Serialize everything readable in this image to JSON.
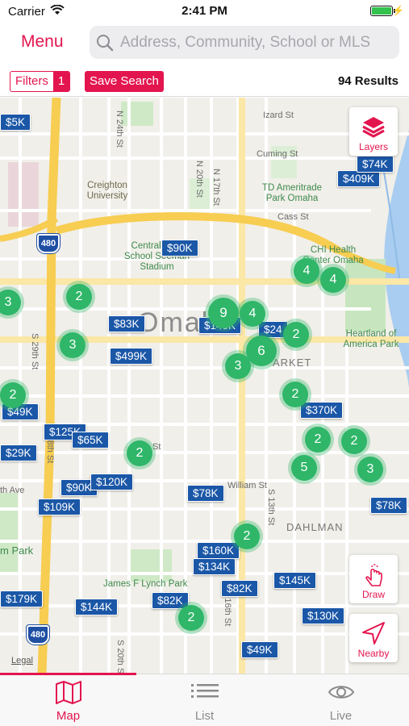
{
  "status": {
    "carrier": "Carrier",
    "time": "2:41 PM"
  },
  "header": {
    "menu_label": "Menu",
    "search_placeholder": "Address, Community, School or MLS"
  },
  "toolbar": {
    "filters_label": "Filters",
    "filters_count": "1",
    "save_search_label": "Save Search",
    "results": "94 Results"
  },
  "map": {
    "city_label": "Omaha",
    "highway": "480",
    "streets": [
      "N 24th St",
      "N 17th St",
      "N 20th St",
      "Izard St",
      "Cuming St",
      "Cass St",
      "S 29th St",
      "S 28th St",
      "St",
      "th Ave",
      "William St",
      "S 13th St",
      "S 16th St",
      "S 20th St"
    ],
    "pois": [
      "Creighton University",
      "Central High School Seeman Stadium",
      "TD Ameritrade Park Omaha",
      "CHI Health Center Omaha",
      "Heartland of America Park",
      "James F Lynch Park",
      "m Park",
      "ARKET",
      "DAHLMAN"
    ],
    "price_pins": [
      "$409K",
      "$74K",
      "$90K",
      "$83K",
      "$145K",
      "$24",
      "$499K",
      "$370K",
      "$49K",
      "$125K",
      "$65K",
      "$29K",
      "$90K",
      "$120K",
      "$109K",
      "$78K",
      "$78K",
      "$160K",
      "$134K",
      "$145K",
      "$82K",
      "$179K",
      "$144K",
      "$82K",
      "$130K",
      "$49K",
      "$5K"
    ],
    "clusters": [
      "3",
      "2",
      "3",
      "9",
      "4",
      "2",
      "6",
      "3",
      "4",
      "4",
      "2",
      "2",
      "2",
      "2",
      "5",
      "3",
      "2",
      "2",
      "2"
    ],
    "layers_label": "Layers",
    "draw_label": "Draw",
    "nearby_label": "Nearby",
    "legal": "Legal"
  },
  "tabs": [
    {
      "label": "Map",
      "icon": "map-icon",
      "active": true
    },
    {
      "label": "List",
      "icon": "list-icon",
      "active": false
    },
    {
      "label": "Live",
      "icon": "eye-icon",
      "active": false
    }
  ],
  "colors": {
    "accent": "#e3154f",
    "pin": "#1b57a7",
    "cluster": "#2fb669"
  }
}
